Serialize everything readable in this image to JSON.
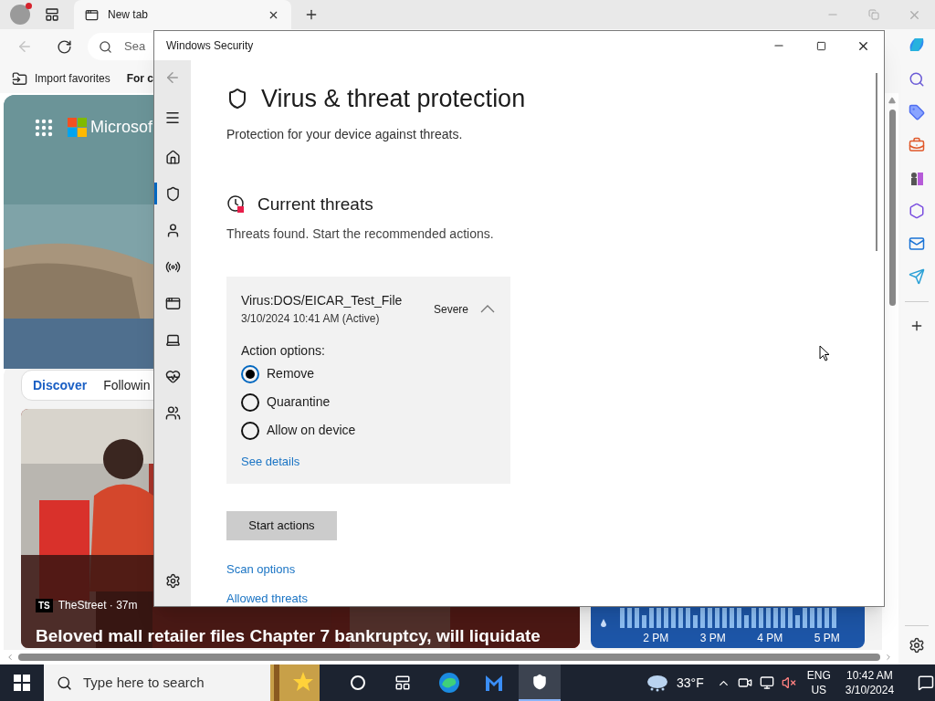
{
  "browser": {
    "tabs": [
      {
        "title": "New tab",
        "selected": true
      }
    ],
    "address_placeholder": "Sea",
    "favorites": [
      "Import favorites",
      "For c"
    ],
    "feed": {
      "brand": "Microsof",
      "tabs": [
        {
          "label": "Discover",
          "selected": true
        },
        {
          "label": "Followin",
          "selected": false
        }
      ],
      "story": {
        "source_logo": "TS",
        "source": "TheStreet · 37m",
        "headline": "Beloved mall retailer files Chapter 7 bankruptcy, will liquidate"
      },
      "weather_times": [
        "2 PM",
        "3 PM",
        "4 PM",
        "5 PM"
      ]
    }
  },
  "security_window": {
    "title": "Windows Security",
    "nav": [
      {
        "kind": "home",
        "selected": false
      },
      {
        "kind": "shield",
        "selected": true
      },
      {
        "kind": "account",
        "selected": false
      },
      {
        "kind": "firewall",
        "selected": false
      },
      {
        "kind": "app",
        "selected": false
      },
      {
        "kind": "device",
        "selected": false
      },
      {
        "kind": "health",
        "selected": false
      },
      {
        "kind": "family",
        "selected": false
      }
    ],
    "heading": "Virus & threat protection",
    "subtitle": "Protection for your device against threats.",
    "section_title": "Current threats",
    "section_text": "Threats found. Start the recommended actions.",
    "threat": {
      "name": "Virus:DOS/EICAR_Test_File",
      "detected": "3/10/2024 10:41 AM (Active)",
      "severity": "Severe",
      "expanded": true,
      "options_label": "Action options:",
      "options": [
        {
          "label": "Remove",
          "selected": true
        },
        {
          "label": "Quarantine",
          "selected": false
        },
        {
          "label": "Allow on device",
          "selected": false
        }
      ],
      "details_link": "See details"
    },
    "primary_button": "Start actions",
    "links": [
      "Scan options",
      "Allowed threats"
    ]
  },
  "taskbar": {
    "search_placeholder": "Type here to search",
    "temperature": "33°F",
    "language": "ENG",
    "region": "US",
    "time": "10:42 AM",
    "date": "3/10/2024"
  }
}
